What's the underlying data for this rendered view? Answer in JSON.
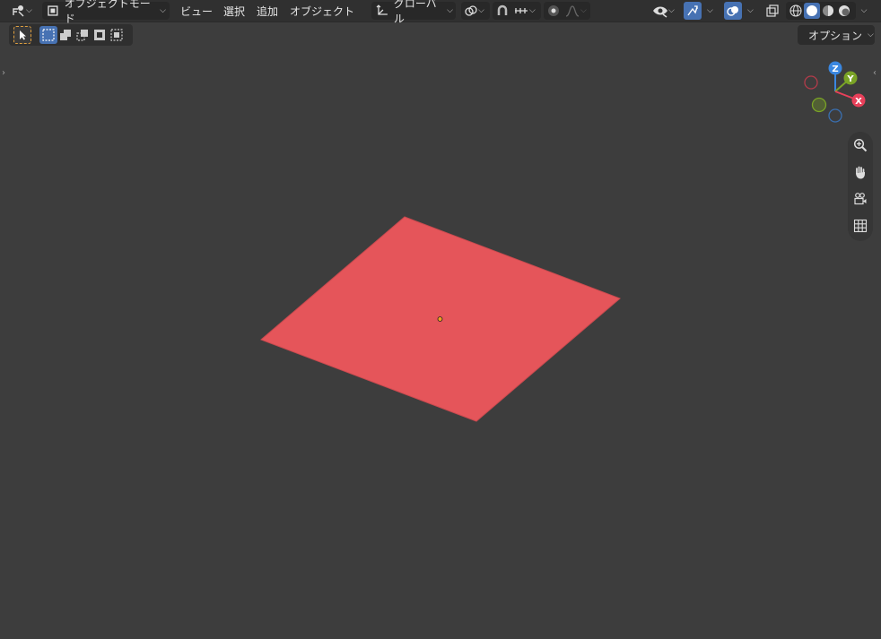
{
  "header": {
    "mode_label": "オブジェクトモード",
    "menus": [
      "ビュー",
      "選択",
      "追加",
      "オブジェクト"
    ],
    "transform_orientation": "グローバル"
  },
  "options_label": "オプション",
  "gizmo": {
    "x": "X",
    "y": "Y",
    "z": "Z"
  },
  "colors": {
    "plane": "#e5555a",
    "viewport_bg": "#3d3d3d",
    "header_bg": "#303030",
    "active_blue": "#4772b3",
    "axis_x": "#e8405a",
    "axis_y": "#7aa326",
    "axis_z": "#3a87e0"
  }
}
